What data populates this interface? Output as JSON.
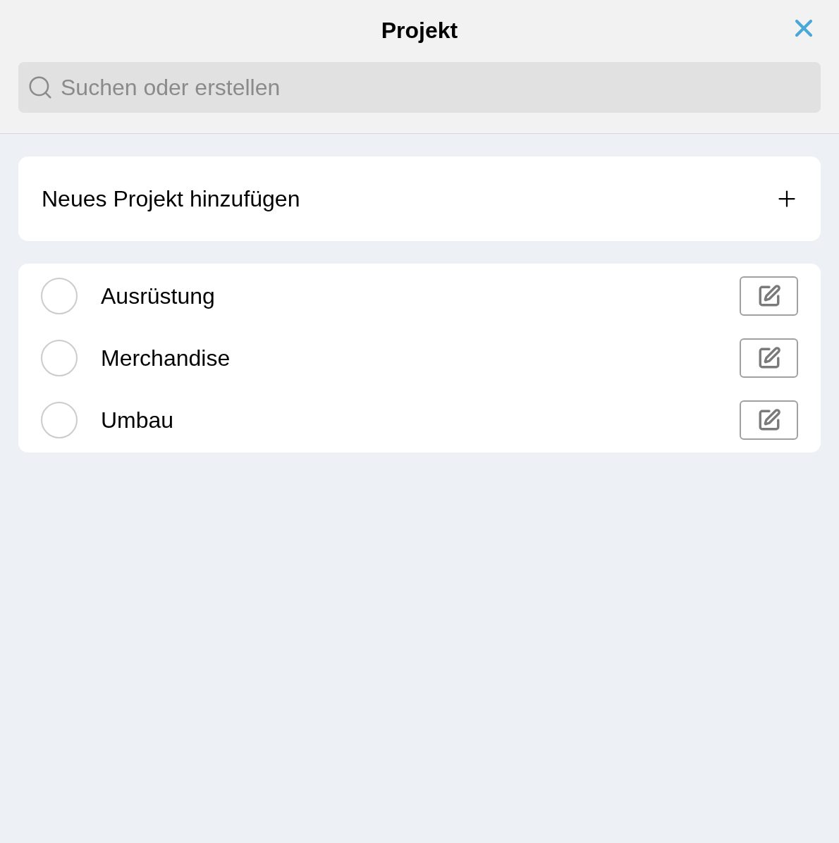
{
  "header": {
    "title": "Projekt"
  },
  "search": {
    "placeholder": "Suchen oder erstellen"
  },
  "add_project": {
    "label": "Neues Projekt hinzufügen"
  },
  "projects": [
    {
      "name": "Ausrüstung",
      "selected": false
    },
    {
      "name": "Merchandise",
      "selected": false
    },
    {
      "name": "Umbau",
      "selected": false
    }
  ]
}
